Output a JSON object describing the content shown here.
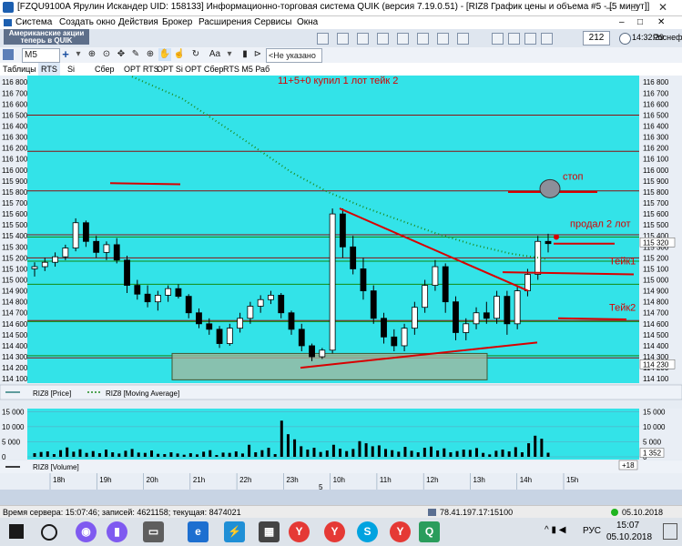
{
  "window": {
    "title": "[FZQU9100A Ярулин Искандер UID: 158133] Информационно-торговая система QUIK (версия 7.19.0.51) - [RIZ8 График цены и объема #5 - [5 минут]]",
    "minimize_label": "–",
    "restore_label": "□",
    "close_label": "✕"
  },
  "menu": [
    "Система",
    "Создать окно",
    "Действия",
    "Брокер",
    "Расширения",
    "Сервисы",
    "Окна"
  ],
  "topstrip": {
    "logo_line1": "Американские акции",
    "logo_line2": "теперь в QUIK",
    "counter": "212",
    "clock": "14:32:29",
    "org": "Роснефт"
  },
  "toolbar": {
    "interval": "M5",
    "add": "+",
    "font": "Aa",
    "filter": "<Не указано"
  },
  "tabs": [
    "Таблицы",
    "RTS",
    "Si",
    "Сбер",
    "OPT RTS",
    "OPT Si",
    "OPT Сбер",
    "RTS M5 Раб"
  ],
  "chart_data": {
    "type": "candlestick",
    "symbol": "RIZ8",
    "interval": "5 минут",
    "y_ticks": [
      116800,
      116700,
      116600,
      116500,
      116400,
      116300,
      116200,
      116100,
      116000,
      115900,
      115800,
      115700,
      115600,
      115500,
      115400,
      115300,
      115200,
      115100,
      115000,
      114900,
      114800,
      114700,
      114600,
      114500,
      114400,
      114300,
      114200,
      114100
    ],
    "ylim": [
      114060,
      116860
    ],
    "x_ticks": [
      "18h",
      "19h",
      "20h",
      "21h",
      "22h",
      "23h",
      "10h",
      "11h",
      "12h",
      "13h",
      "14h",
      "15h"
    ],
    "price_marker": "115 320",
    "low_marker": "114 230",
    "legend": [
      {
        "name": "RIZ8 [Price]",
        "color": "#2f7f7f"
      },
      {
        "name": "RIZ8 [Moving Average]",
        "color": "#1d8a1d"
      }
    ],
    "volume_ticks": [
      "15 000",
      "10 000",
      "5 000",
      "0"
    ],
    "volume_marker": "1 352",
    "volume_label": "RIZ8 [Volume]",
    "volume_ylim": [
      0,
      16000
    ],
    "zoom_label": "+18",
    "bottom_label": "5",
    "annotations": [
      {
        "text": "11+5+0 купил 1 лот тейк 2",
        "color": "#d80000"
      },
      {
        "text": "стоп",
        "color": "#d80000"
      },
      {
        "text": "продал 2 лот",
        "color": "#d80000"
      },
      {
        "text": "Тейк1",
        "color": "#d80000"
      },
      {
        "text": "Тейк2",
        "color": "#d80000"
      }
    ],
    "hlines_dark": [
      116500,
      116170,
      115810,
      115410,
      115200,
      114630,
      114290
    ],
    "hlines_green": [
      115390,
      115170,
      114960,
      114620,
      114310
    ],
    "candles": [
      [
        115100,
        115160,
        115030,
        115120
      ],
      [
        115120,
        115200,
        115080,
        115160
      ],
      [
        115160,
        115250,
        115120,
        115210
      ],
      [
        115210,
        115320,
        115180,
        115290
      ],
      [
        115290,
        115560,
        115260,
        115520
      ],
      [
        115520,
        115540,
        115300,
        115350
      ],
      [
        115350,
        115400,
        115200,
        115250
      ],
      [
        115250,
        115350,
        115180,
        115320
      ],
      [
        115320,
        115380,
        115150,
        115180
      ],
      [
        115180,
        115220,
        114880,
        114950
      ],
      [
        114950,
        115000,
        114820,
        114870
      ],
      [
        114870,
        114950,
        114750,
        114800
      ],
      [
        114800,
        114900,
        114720,
        114860
      ],
      [
        114860,
        114950,
        114800,
        114920
      ],
      [
        114920,
        114960,
        114830,
        114850
      ],
      [
        114850,
        114870,
        114650,
        114700
      ],
      [
        114700,
        114740,
        114560,
        114600
      ],
      [
        114600,
        114650,
        114500,
        114550
      ],
      [
        114550,
        114580,
        114380,
        114420
      ],
      [
        114420,
        114600,
        114400,
        114560
      ],
      [
        114560,
        114700,
        114520,
        114650
      ],
      [
        114650,
        114800,
        114600,
        114760
      ],
      [
        114760,
        114860,
        114700,
        114820
      ],
      [
        114820,
        114900,
        114780,
        114860
      ],
      [
        114860,
        114880,
        114650,
        114700
      ],
      [
        114700,
        114720,
        114500,
        114550
      ],
      [
        114550,
        114600,
        114350,
        114400
      ],
      [
        114400,
        114420,
        114260,
        114300
      ],
      [
        114300,
        114380,
        114280,
        114360
      ],
      [
        114360,
        115650,
        114330,
        115600
      ],
      [
        115600,
        115650,
        115200,
        115300
      ],
      [
        115300,
        115400,
        115050,
        115100
      ],
      [
        115100,
        115200,
        114820,
        114900
      ],
      [
        114900,
        114950,
        114600,
        114650
      ],
      [
        114650,
        114700,
        114420,
        114480
      ],
      [
        114480,
        114550,
        114350,
        114400
      ],
      [
        114400,
        114600,
        114350,
        114560
      ],
      [
        114560,
        114800,
        114500,
        114750
      ],
      [
        114750,
        115000,
        114700,
        114950
      ],
      [
        114950,
        115180,
        114900,
        115120
      ],
      [
        115120,
        115150,
        114700,
        114800
      ],
      [
        114800,
        114850,
        114450,
        114520
      ],
      [
        114520,
        114650,
        114450,
        114600
      ],
      [
        114600,
        114750,
        114550,
        114700
      ],
      [
        114700,
        114800,
        114600,
        114650
      ],
      [
        114650,
        114900,
        114600,
        114850
      ],
      [
        114850,
        114900,
        114500,
        114600
      ],
      [
        114600,
        114950,
        114550,
        114900
      ],
      [
        114900,
        115100,
        114850,
        115050
      ],
      [
        115050,
        115400,
        115000,
        115350
      ],
      [
        115350,
        115420,
        115250,
        115330
      ]
    ],
    "volumes": [
      1200,
      1600,
      1800,
      900,
      2200,
      3100,
      1700,
      2500,
      1300,
      1900,
      1200,
      2400,
      1500,
      1100,
      2000,
      2600,
      1400,
      1300,
      2100,
      1000,
      900,
      1500,
      1100,
      700,
      1200,
      800,
      1700,
      2200,
      600,
      1400,
      1300,
      1800,
      1100,
      4000,
      1500,
      2200,
      3000,
      900,
      12000,
      7500,
      5800,
      3500,
      2400,
      3000,
      1600,
      2100,
      4000,
      2700,
      1900,
      2600,
      5200,
      4500,
      3500,
      3800,
      2600,
      2200,
      1700,
      3300,
      2000,
      1500,
      3000,
      3400,
      2100,
      2800,
      1500,
      1900,
      2400,
      2300,
      2900,
      1300,
      800,
      2000,
      2400,
      1800,
      3200,
      1500,
      4500,
      7000,
      6000,
      1352
    ]
  },
  "statusbar": {
    "server_time": "Время сервера: 15:07:46; записей: 4621158; текущая: 8474021",
    "ip": "78.41.197.17:15100",
    "date": "05.10.2018"
  },
  "taskbar": {
    "lang": "РУС",
    "time": "15:07",
    "date": "05.10.2018"
  }
}
